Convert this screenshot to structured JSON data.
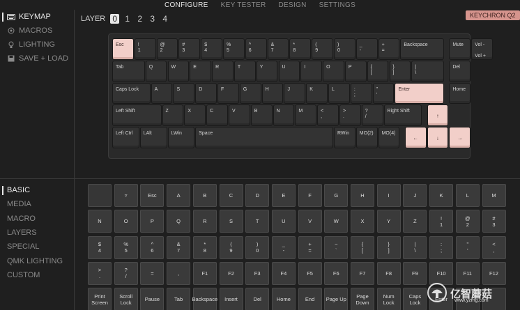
{
  "nav": {
    "tabs": [
      "CONFIGURE",
      "KEY TESTER",
      "DESIGN",
      "SETTINGS"
    ]
  },
  "sidebar_top": [
    {
      "label": "KEYMAP",
      "icon": "keyboard-icon"
    },
    {
      "label": "MACROS",
      "icon": "macro-target-icon"
    },
    {
      "label": "LIGHTING",
      "icon": "bulb-icon"
    },
    {
      "label": "SAVE + LOAD",
      "icon": "save-icon"
    }
  ],
  "sidebar_bottom": [
    "BASIC",
    "MEDIA",
    "MACRO",
    "LAYERS",
    "SPECIAL",
    "QMK LIGHTING",
    "CUSTOM"
  ],
  "layer": {
    "label": "LAYER",
    "numbers": [
      "0",
      "1",
      "2",
      "3",
      "4"
    ]
  },
  "keyboard_name": "KEYCHRON Q2",
  "keyboard": [
    [
      "Esc",
      "!\n1",
      "@\n2",
      "#\n3",
      "$\n4",
      "%\n5",
      "^\n6",
      "&\n7",
      "*\n8",
      "(\n9",
      ")\n0",
      "_\n-",
      "+\n=",
      "Backspace",
      "Mute",
      "Vol -\n\nVol +"
    ],
    [
      "Tab",
      "Q",
      "W",
      "E",
      "R",
      "T",
      "Y",
      "U",
      "I",
      "O",
      "P",
      "{\n[",
      "}\n]",
      "|\n\\",
      "Del"
    ],
    [
      "Caps Lock",
      "A",
      "S",
      "D",
      "F",
      "G",
      "H",
      "J",
      "K",
      "L",
      ":\n;",
      "\"\n'",
      "Enter",
      "Home"
    ],
    [
      "Left Shift",
      "Z",
      "X",
      "C",
      "V",
      "B",
      "N",
      "M",
      "<\n,",
      ">\n.",
      "?\n/",
      "Right Shift",
      "↑"
    ],
    [
      "Left Ctrl",
      "LAlt",
      "LWin",
      "Space",
      "RWin",
      "MO(2)",
      "MO(4)",
      "←",
      "↓",
      "→"
    ]
  ],
  "keycodes": [
    [
      "",
      "▿",
      "Esc",
      "A",
      "B",
      "C",
      "D",
      "E",
      "F",
      "G",
      "H",
      "I",
      "J",
      "K",
      "L",
      "M"
    ],
    [
      "N",
      "O",
      "P",
      "Q",
      "R",
      "S",
      "T",
      "U",
      "V",
      "W",
      "X",
      "Y",
      "Z",
      "!\n1",
      "@\n2",
      "#\n3"
    ],
    [
      "$\n4",
      "%\n5",
      "^\n6",
      "&\n7",
      "*\n8",
      "(\n9",
      ")\n0",
      "_\n-",
      "+\n=",
      "~\n`",
      "{\n[",
      "}\n]",
      "|\n\\",
      ":\n;",
      "\"\n'",
      "<\n,"
    ],
    [
      ">\n.",
      "?\n/",
      "=",
      ",",
      "F1",
      "F2",
      "F3",
      "F4",
      "F5",
      "F6",
      "F7",
      "F8",
      "F9",
      "F10",
      "F11",
      "F12"
    ],
    [
      "Print\nScreen",
      "Scroll\nLock",
      "Pause",
      "Tab",
      "Backspace",
      "Insert",
      "Del",
      "Home",
      "End",
      "Page Up",
      "Page\nDown",
      "Num\nLock",
      "Caps\nLock",
      "Enter",
      "",
      ""
    ]
  ],
  "watermark": {
    "main": "亿智蘑菇",
    "sub": "www.yzmg.com"
  },
  "colors": {
    "accent": "#f2cfc9",
    "badge": "#d6948d",
    "background": "#1f1f1f"
  }
}
